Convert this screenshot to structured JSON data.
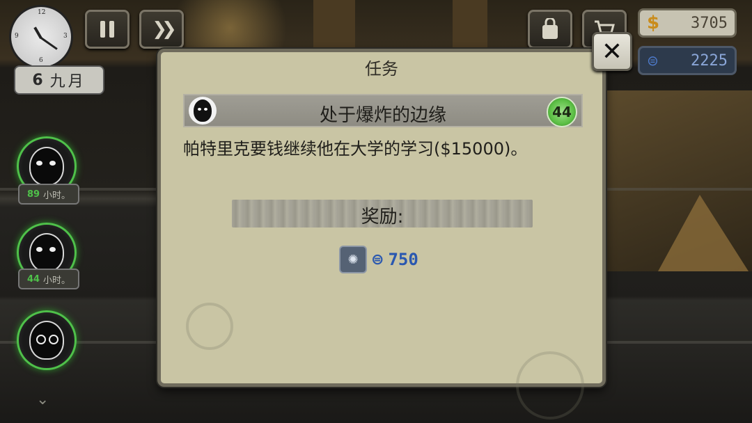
{
  "hud": {
    "date_day": "6",
    "date_month": "九月",
    "money_symbol": "$",
    "money": "3705",
    "tokens": "2225"
  },
  "tenants": [
    {
      "hours": "89",
      "unit": "小时。"
    },
    {
      "hours": "44",
      "unit": "小时。"
    },
    {
      "hours": "",
      "unit": ""
    }
  ],
  "modal": {
    "title": "任务",
    "quest_name": "处于爆炸的边缘",
    "quest_level": "44",
    "description": "帕特里克要钱继续他在大学的学习($15000)。",
    "reward_label": "奖励:",
    "reward_value": "750"
  },
  "colors": {
    "panel": "#c9c5a4",
    "accent_green": "#4fc14a",
    "token_blue": "#2a58b0",
    "money_gold": "#c98c1c"
  },
  "icons": {
    "close": "close-icon",
    "pause": "pause-icon",
    "fast_forward": "fast-forward-icon",
    "inventory": "bag-icon",
    "shop": "cart-icon",
    "reward": "token-badge-icon"
  }
}
